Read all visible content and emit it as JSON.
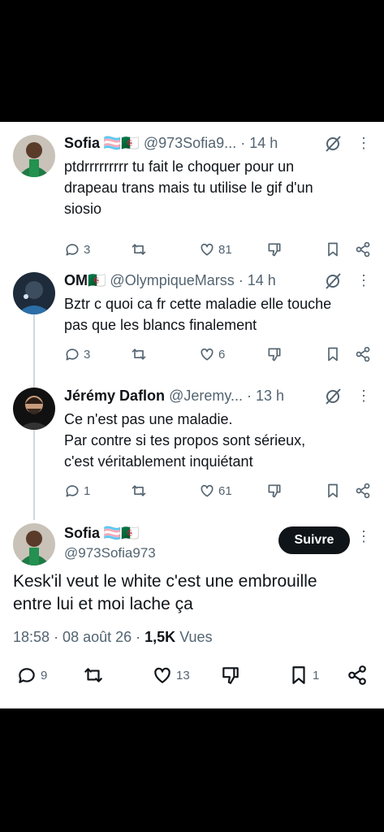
{
  "replies": [
    {
      "name": "Sofia",
      "flags": "🏳️‍⚧️🇩🇿",
      "handle": "@973Sofia9...",
      "time": "· 14 h",
      "text": "ptdrrrrrrrrr tu fait le choquer pour un\ndrapeau trans mais tu utilise le gif d'un\nsiosio",
      "replies_count": "3",
      "retweets_count": "",
      "likes_count": "81",
      "more": "⋮"
    },
    {
      "name": "OM",
      "flags": "🇩🇿",
      "handle": "@OlympiqueMarss",
      "time": "· 14 h",
      "text": "Bztr c quoi ca fr cette maladie elle touche\npas que les blancs finalement",
      "replies_count": "3",
      "retweets_count": "",
      "likes_count": "6",
      "more": "⋮"
    },
    {
      "name": "Jérémy Daflon",
      "flags": "",
      "handle": "@Jeremy...",
      "time": "· 13 h",
      "text": "Ce n'est pas une maladie.\nPar contre si tes propos sont sérieux,\nc'est véritablement inquiétant",
      "replies_count": "1",
      "retweets_count": "",
      "likes_count": "61",
      "more": "⋮"
    }
  ],
  "main_tweet": {
    "name": "Sofia",
    "flags": "🏳️‍⚧️🇩🇿",
    "handle": "@973Sofia973",
    "follow_label": "Suivre",
    "more": "⋮",
    "text": "Kesk'il veut le white c'est une embrouille\nentre lui et moi lache ça",
    "time": "18:58",
    "date": "· 08 août 26 ·",
    "views_count": "1,5K",
    "views_label": "Vues",
    "replies_count": "9",
    "likes_count": "13",
    "bookmarks_count": "1"
  },
  "colors": {
    "text": "#0f1419",
    "secondary": "#536471",
    "follow_button": "#0f1419",
    "background": "#ffffff",
    "frame": "#000000"
  },
  "icons": [
    "reply-icon",
    "retweet-icon",
    "like-icon",
    "dislike-icon",
    "bookmark-icon",
    "share-icon",
    "grok-icon",
    "more-icon"
  ]
}
